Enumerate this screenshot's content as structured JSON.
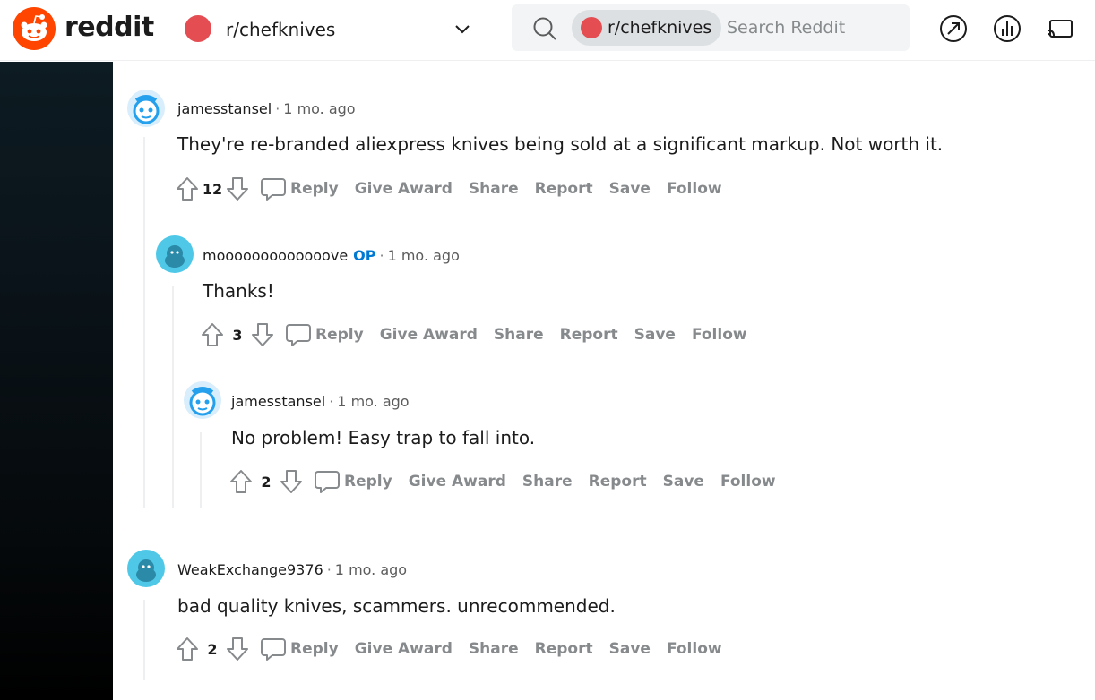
{
  "header": {
    "wordmark": "reddit",
    "community": "r/chefknives",
    "search_chip": "r/chefknives",
    "search_placeholder": "Search Reddit"
  },
  "action_labels": {
    "reply": "Reply",
    "give_award": "Give Award",
    "share": "Share",
    "report": "Report",
    "save": "Save",
    "follow": "Follow"
  },
  "comments": [
    {
      "author": "jamesstansel",
      "time": "1 mo. ago",
      "op": "",
      "text": "They're re-branded aliexpress knives being sold at a significant markup. Not worth it.",
      "score": "12"
    },
    {
      "author": "mooooooooooooove",
      "time": "1 mo. ago",
      "op": "OP",
      "text": "Thanks!",
      "score": "3"
    },
    {
      "author": "jamesstansel",
      "time": "1 mo. ago",
      "op": "",
      "text": "No problem! Easy trap to fall into.",
      "score": "2"
    },
    {
      "author": "WeakExchange9376",
      "time": "1 mo. ago",
      "op": "",
      "text": "bad quality knives, scammers. unrecommended.",
      "score": "2"
    }
  ],
  "colors": {
    "brand": "#ff4500",
    "op": "#0079d3",
    "action_gray": "#878a8c"
  }
}
